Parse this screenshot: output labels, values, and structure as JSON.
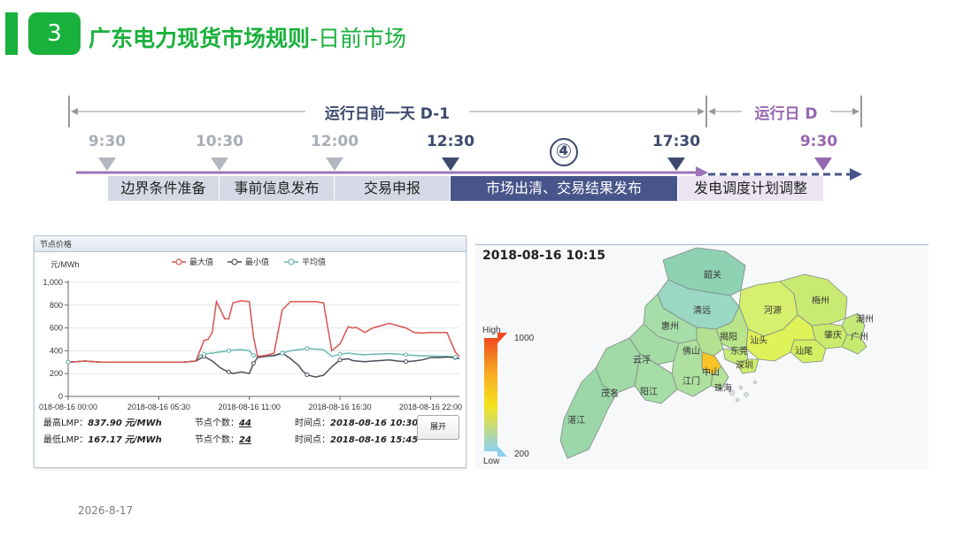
{
  "header": {
    "number": "3",
    "title": "广东电力现货市场规则",
    "subtitle": "-日前市场"
  },
  "timeline": {
    "day_before_label": "运行日前一天 D-1",
    "day_label": "运行日 D",
    "circle_step": "④",
    "times": [
      "9:30",
      "10:30",
      "12:00",
      "12:30",
      "17:30",
      "9:30"
    ],
    "phases": [
      "边界条件准备",
      "事前信息发布",
      "交易申报",
      "市场出清、交易结果发布",
      "发电调度计划调整"
    ]
  },
  "panel": {
    "title": "节点价格",
    "unit": "元/MWh",
    "legend": [
      "最大值",
      "最小值",
      "平均值"
    ],
    "expand_button": "展开",
    "stats": {
      "max_label": "最高LMP：",
      "max_value": "837.90",
      "min_label": "最低LMP：",
      "min_value": "167.17",
      "unit": "元/MWh",
      "count_label": "节点个数：",
      "max_count": "44",
      "min_count": "24",
      "time_label": "时间点：",
      "max_time": "2018-08-16 10:30",
      "min_time": "2018-08-16 15:45"
    }
  },
  "chart_data": {
    "type": "line",
    "title": "节点价格",
    "ylabel": "元/MWh",
    "xlabel": "",
    "ylim": [
      0,
      1000
    ],
    "yticks": [
      "0",
      "200",
      "400",
      "600",
      "800",
      "1,000"
    ],
    "xticks": [
      "018-08-16 00:00",
      "2018-08-16 05:30",
      "2018-08-16 11:00",
      "2018-08-16 16:30",
      "2018-08-16 22:00"
    ],
    "xtick_hours": [
      0,
      5.5,
      11,
      16.5,
      22
    ],
    "xlim_hours": [
      0,
      23.75
    ],
    "x_hours": [
      0,
      0.5,
      1,
      2,
      3,
      4,
      5,
      6,
      7,
      7.75,
      8,
      8.25,
      8.5,
      8.75,
      9,
      9.25,
      9.5,
      9.75,
      10,
      10.5,
      11,
      11.25,
      11.5,
      11.75,
      12,
      12.5,
      13,
      13.5,
      14,
      14.25,
      14.5,
      15,
      15.5,
      16,
      16.5,
      17,
      17.25,
      17.5,
      18,
      18.5,
      19,
      19.5,
      20,
      20.5,
      21,
      21.5,
      22,
      22.5,
      23,
      23.5,
      23.75
    ],
    "series": [
      {
        "name": "最大值",
        "color": "#d9534f",
        "values": [
          300,
          305,
          310,
          300,
          300,
          300,
          300,
          300,
          300,
          310,
          400,
          490,
          500,
          560,
          830,
          760,
          680,
          680,
          820,
          838,
          830,
          520,
          350,
          355,
          360,
          380,
          760,
          830,
          830,
          830,
          830,
          830,
          820,
          400,
          460,
          610,
          600,
          605,
          560,
          600,
          620,
          640,
          620,
          600,
          560,
          555,
          560,
          560,
          560,
          390,
          350
        ]
      },
      {
        "name": "最小值",
        "color": "#4a4f5a",
        "values": [
          300,
          305,
          310,
          300,
          300,
          300,
          300,
          300,
          300,
          310,
          330,
          350,
          330,
          310,
          280,
          250,
          230,
          215,
          200,
          215,
          200,
          290,
          340,
          345,
          350,
          360,
          380,
          330,
          270,
          220,
          190,
          170,
          185,
          260,
          320,
          330,
          315,
          310,
          305,
          310,
          315,
          320,
          310,
          305,
          310,
          320,
          340,
          340,
          345,
          340,
          330
        ]
      },
      {
        "name": "平均值",
        "color": "#6bb7b0",
        "values": [
          300,
          305,
          310,
          300,
          300,
          300,
          300,
          300,
          300,
          310,
          360,
          370,
          375,
          380,
          385,
          390,
          395,
          400,
          405,
          410,
          400,
          360,
          350,
          350,
          352,
          355,
          380,
          400,
          410,
          415,
          420,
          415,
          410,
          350,
          370,
          380,
          375,
          370,
          365,
          370,
          372,
          375,
          370,
          365,
          360,
          355,
          355,
          352,
          350,
          345,
          335
        ]
      }
    ]
  },
  "map": {
    "timestamp": "2018-08-16 10:15",
    "legend_high": "High",
    "legend_low": "Low",
    "legend_max": "1000",
    "legend_min": "200",
    "cities": [
      "韶关",
      "清远",
      "河源",
      "梅州",
      "潮州",
      "肇庆",
      "广州",
      "惠州",
      "揭阳",
      "汕头",
      "汕尾",
      "云浮",
      "佛山",
      "东莞",
      "深圳",
      "中山",
      "江门",
      "珠海",
      "茂名",
      "阳江",
      "湛江"
    ]
  },
  "footer": {
    "date": "2026-8-17"
  }
}
